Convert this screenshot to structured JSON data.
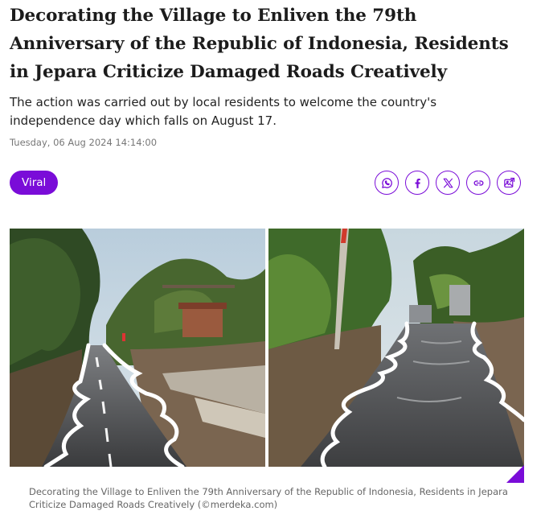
{
  "article": {
    "title": "Decorating the Village to Enliven the 79th Anniversary of the Republic of Indonesia, Residents in Jepara Criticize Damaged Roads Creatively",
    "summary": "The action was carried out by local residents to welcome the country's independence day which falls on August 17.",
    "date": "Tuesday, 06 Aug 2024 14:14:00",
    "tag": "Viral",
    "caption": "Decorating the Village to Enliven the 79th Anniversary of the Republic of Indonesia, Residents in Jepara Criticize Damaged Roads Creatively (©merdeka.com)"
  },
  "share": {
    "icons": [
      "whatsapp-icon",
      "facebook-icon",
      "x-icon",
      "link-icon",
      "image-share-icon"
    ]
  },
  "colors": {
    "accent": "#7a0cd8",
    "title": "#1c1c1c",
    "meta": "#777777"
  }
}
